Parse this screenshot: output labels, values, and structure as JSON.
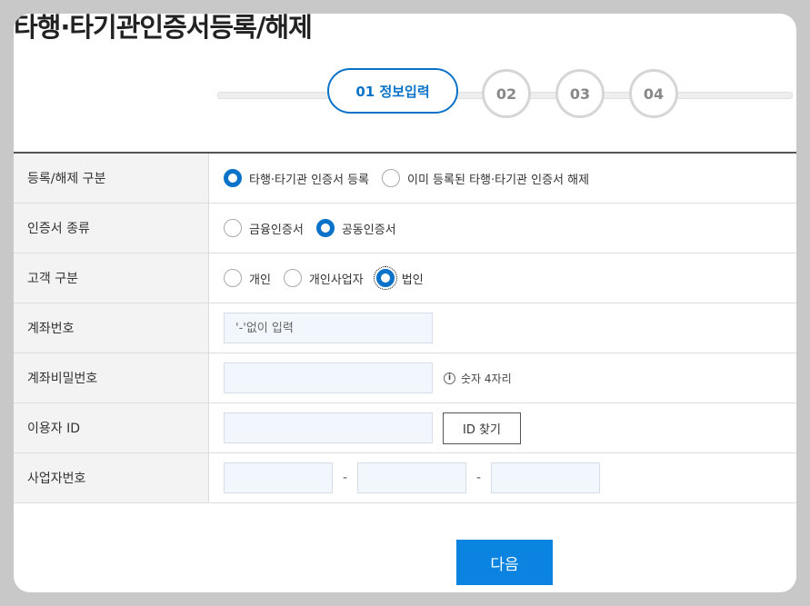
{
  "page_title": "타행·타기관인증서등록/해제",
  "stepper": {
    "active_label": "01 정보입력",
    "steps": [
      "02",
      "03",
      "04"
    ]
  },
  "rows": {
    "reg_type": {
      "label": "등록/해제 구분",
      "options": [
        "타행·타기관 인증서 등록",
        "이미 등록된 타행·타기관 인증서 해제"
      ],
      "selected": "타행·타기관 인증서 등록"
    },
    "cert_type": {
      "label": "인증서 종류",
      "options": [
        "금융인증서",
        "공동인증서"
      ],
      "selected": "공동인증서"
    },
    "customer_type": {
      "label": "고객 구분",
      "options": [
        "개인",
        "개인사업자",
        "법인"
      ],
      "selected": "법인"
    },
    "account_number": {
      "label": "계좌번호",
      "placeholder": "'-'없이 입력"
    },
    "account_password": {
      "label": "계좌비밀번호",
      "hint": "숫자 4자리"
    },
    "user_id": {
      "label": "이용자 ID",
      "button": "ID 찾기"
    },
    "business_number": {
      "label": "사업자번호",
      "separator": "-"
    }
  },
  "next_button": "다음",
  "colors": {
    "accent": "#0a73c9",
    "button_blue": "#0a84e0",
    "input_bg": "#f2f7fd",
    "label_bg": "#f3f3f3"
  }
}
